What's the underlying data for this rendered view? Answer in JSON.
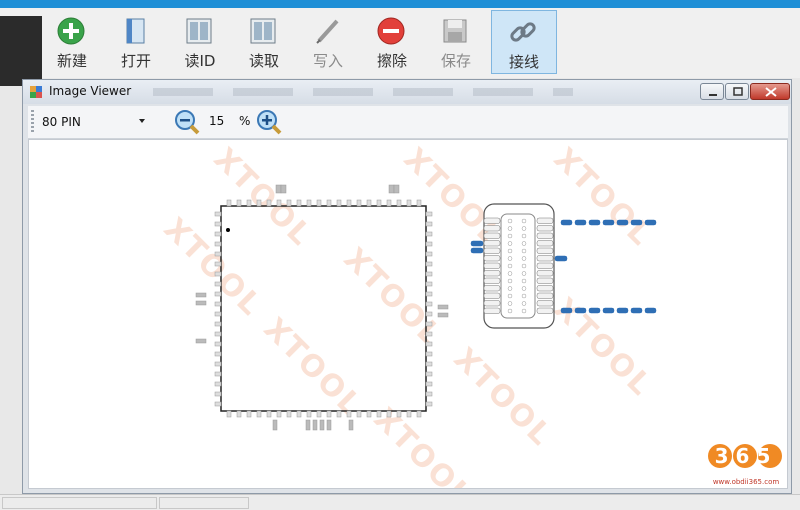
{
  "toolbar": {
    "buttons": [
      {
        "label": "新建",
        "icon": "add-icon",
        "state": "enabled"
      },
      {
        "label": "打开",
        "icon": "open-file-icon",
        "state": "enabled"
      },
      {
        "label": "读ID",
        "icon": "read-id-icon",
        "state": "enabled"
      },
      {
        "label": "读取",
        "icon": "read-icon",
        "state": "enabled"
      },
      {
        "label": "写入",
        "icon": "write-pen-icon",
        "state": "disabled"
      },
      {
        "label": "擦除",
        "icon": "erase-icon",
        "state": "enabled"
      },
      {
        "label": "保存",
        "icon": "save-disk-icon",
        "state": "disabled"
      },
      {
        "label": "接线",
        "icon": "wiring-link-icon",
        "state": "active"
      }
    ]
  },
  "viewer": {
    "title": "Image Viewer",
    "pin_select": "80 PIN",
    "zoom_value": "15",
    "zoom_unit": "%"
  },
  "watermark": {
    "text": "XTOOL"
  },
  "logo": {
    "text": "365",
    "url": "www.obdii365.com"
  },
  "colors": {
    "accent": "#1f8fd6",
    "active_bg": "#cfe6f7",
    "close": "#c0392b",
    "watermark": "#f6c9b3",
    "pin_blue": "#2f6fb5"
  }
}
